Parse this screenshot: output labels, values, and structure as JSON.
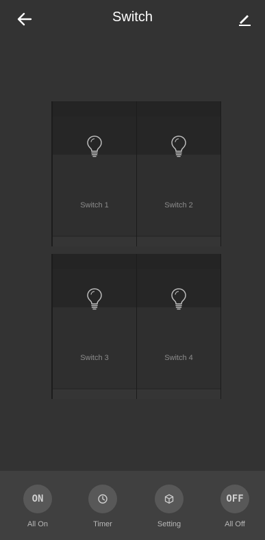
{
  "header": {
    "title": "Switch",
    "back_icon": "arrow-left-icon",
    "edit_icon": "pencil-icon"
  },
  "switches": [
    {
      "label": "Switch 1",
      "icon": "lightbulb-icon"
    },
    {
      "label": "Switch 2",
      "icon": "lightbulb-icon"
    },
    {
      "label": "Switch 3",
      "icon": "lightbulb-icon"
    },
    {
      "label": "Switch 4",
      "icon": "lightbulb-icon"
    }
  ],
  "bottom_bar": {
    "all_on": {
      "icon_text": "ON",
      "label": "All On"
    },
    "timer": {
      "icon": "clock-icon",
      "label": "Timer"
    },
    "setting": {
      "icon": "cube-icon",
      "label": "Setting"
    },
    "all_off": {
      "icon_text": "OFF",
      "label": "All Off"
    }
  },
  "colors": {
    "background": "#333333",
    "panel": "#1c1c1c",
    "bottom_bar": "#404040",
    "button_circle": "#585858"
  }
}
